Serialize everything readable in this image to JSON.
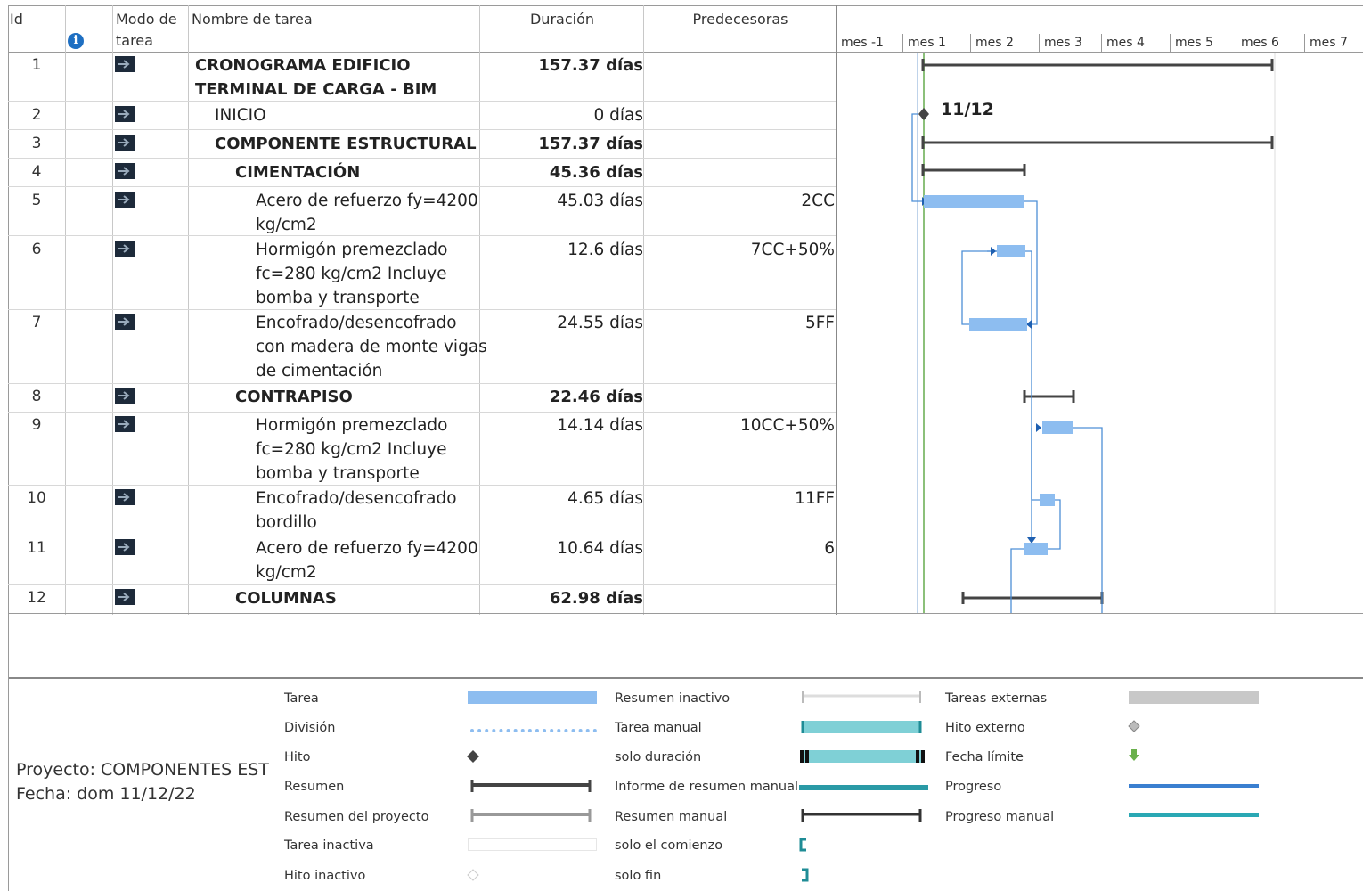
{
  "columns": {
    "id": "Id",
    "mode_line1": "Modo de",
    "mode_line2": "tarea",
    "name": "Nombre de tarea",
    "duration": "Duración",
    "predecessors": "Predecesoras"
  },
  "timescale": [
    "mes -1",
    "mes 1",
    "mes 2",
    "mes 3",
    "mes 4",
    "mes 5",
    "mes 6",
    "mes 7"
  ],
  "tasks": [
    {
      "id": "1",
      "name": [
        "CRONOGRAMA EDIFICIO",
        "TERMINAL DE CARGA - BIM"
      ],
      "duration": "157.37 días",
      "pred": "",
      "bold": true,
      "indent": 0
    },
    {
      "id": "2",
      "name": [
        "INICIO"
      ],
      "duration": "0 días",
      "pred": "",
      "bold": false,
      "indent": 1
    },
    {
      "id": "3",
      "name": [
        "COMPONENTE ESTRUCTURAL"
      ],
      "duration": "157.37 días",
      "pred": "",
      "bold": true,
      "indent": 1
    },
    {
      "id": "4",
      "name": [
        "CIMENTACIÓN"
      ],
      "duration": "45.36 días",
      "pred": "",
      "bold": true,
      "indent": 2
    },
    {
      "id": "5",
      "name": [
        "Acero de refuerzo fy=4200",
        "kg/cm2"
      ],
      "duration": "45.03 días",
      "pred": "2CC",
      "bold": false,
      "indent": 3
    },
    {
      "id": "6",
      "name": [
        "Hormigón premezclado",
        "fc=280 kg/cm2 Incluye",
        "bomba y transporte"
      ],
      "duration": "12.6 días",
      "pred": "7CC+50%",
      "bold": false,
      "indent": 3
    },
    {
      "id": "7",
      "name": [
        "Encofrado/desencofrado",
        "con madera de monte vigas",
        "de cimentación"
      ],
      "duration": "24.55 días",
      "pred": "5FF",
      "bold": false,
      "indent": 3
    },
    {
      "id": "8",
      "name": [
        "CONTRAPISO"
      ],
      "duration": "22.46 días",
      "pred": "",
      "bold": true,
      "indent": 2
    },
    {
      "id": "9",
      "name": [
        "Hormigón premezclado",
        "fc=280 kg/cm2 Incluye",
        "bomba y transporte"
      ],
      "duration": "14.14 días",
      "pred": "10CC+50%",
      "bold": false,
      "indent": 3
    },
    {
      "id": "10",
      "name": [
        "Encofrado/desencofrado",
        "bordillo"
      ],
      "duration": "4.65 días",
      "pred": "11FF",
      "bold": false,
      "indent": 3
    },
    {
      "id": "11",
      "name": [
        "Acero de refuerzo fy=4200",
        "kg/cm2"
      ],
      "duration": "10.64 días",
      "pred": "6",
      "bold": false,
      "indent": 3
    },
    {
      "id": "12",
      "name": [
        "COLUMNAS"
      ],
      "duration": "62.98 días",
      "pred": "",
      "bold": true,
      "indent": 2
    }
  ],
  "milestone_label": "11/12",
  "footer": {
    "project": "Proyecto: COMPONENTES EST",
    "date": "Fecha: dom 11/12/22"
  },
  "legend": [
    [
      "Tarea",
      "División",
      "Hito",
      "Resumen",
      "Resumen del proyecto",
      "Tarea inactiva",
      "Hito inactivo"
    ],
    [
      "Resumen inactivo",
      "Tarea manual",
      "solo duración",
      "Informe de resumen manual",
      "Resumen manual",
      "solo el comienzo",
      "solo fin"
    ],
    [
      "Tareas externas",
      "Hito externo",
      "Fecha límite",
      "Progreso",
      "Progreso manual"
    ]
  ],
  "colors": {
    "task_bar": "#8dbdf0",
    "summary_bar": "#444444",
    "link": "#4d8fd6",
    "manual": "#7fd0d6",
    "deadline": "#6ab04c"
  }
}
